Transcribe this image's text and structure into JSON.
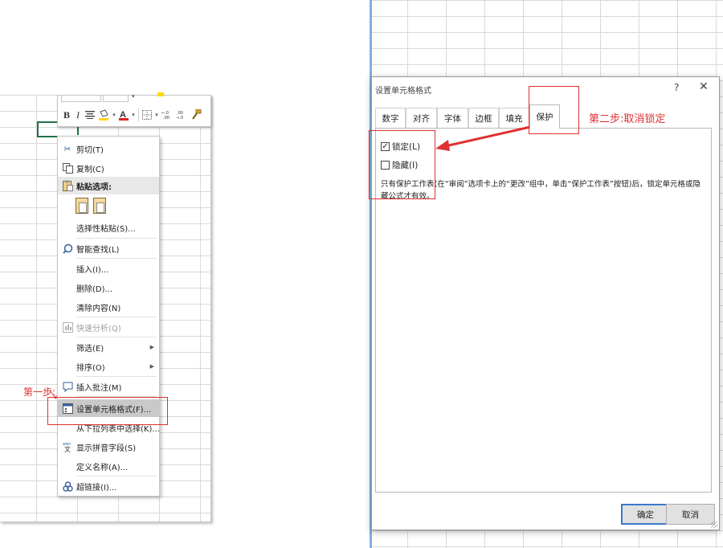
{
  "context_menu": {
    "items": [
      {
        "label": "剪切(T)",
        "icon": "scissors-icon"
      },
      {
        "label": "复制(C)",
        "icon": "copy-icon"
      },
      {
        "label": "粘贴选项:",
        "icon": "paste-icon"
      },
      {
        "label": "选择性粘贴(S)...",
        "icon": ""
      },
      {
        "label": "智能查找(L)",
        "icon": "smart-lookup-icon"
      },
      {
        "label": "插入(I)...",
        "icon": ""
      },
      {
        "label": "删除(D)...",
        "icon": ""
      },
      {
        "label": "清除内容(N)",
        "icon": ""
      },
      {
        "label": "快速分析(Q)",
        "icon": "quick-analysis-icon"
      },
      {
        "label": "筛选(E)",
        "icon": ""
      },
      {
        "label": "排序(O)",
        "icon": ""
      },
      {
        "label": "插入批注(M)",
        "icon": "comment-icon"
      },
      {
        "label": "设置单元格格式(F)...",
        "icon": "format-cells-icon"
      },
      {
        "label": "从下拉列表中选择(K)...",
        "icon": ""
      },
      {
        "label": "显示拼音字段(S)",
        "icon": "phonetic-icon"
      },
      {
        "label": "定义名称(A)...",
        "icon": ""
      },
      {
        "label": "超链接(I)...",
        "icon": "hyperlink-icon"
      }
    ]
  },
  "annotations": {
    "step1": "第一步:",
    "step2": "第二步:取消锁定"
  },
  "dialog": {
    "title": "设置单元格格式",
    "help": "?",
    "close": "✕",
    "tabs": [
      "数字",
      "对齐",
      "字体",
      "边框",
      "填充",
      "保护"
    ],
    "active_tab": "保护",
    "locked_label": "锁定(L)",
    "locked_checked": true,
    "hidden_label": "隐藏(I)",
    "hidden_checked": false,
    "description": "只有保护工作表(在“审阅”选项卡上的“更改”组中，单击“保护工作表”按钮)后，锁定单元格或隐藏公式才有效。",
    "ok_label": "确定",
    "cancel_label": "取消"
  },
  "colors": {
    "annotation_red": "#e03030",
    "excel_green": "#217346",
    "font_color_red": "#e02020",
    "highlight_yellow": "#ffd800",
    "primary_button_border": "#3a78c9"
  }
}
